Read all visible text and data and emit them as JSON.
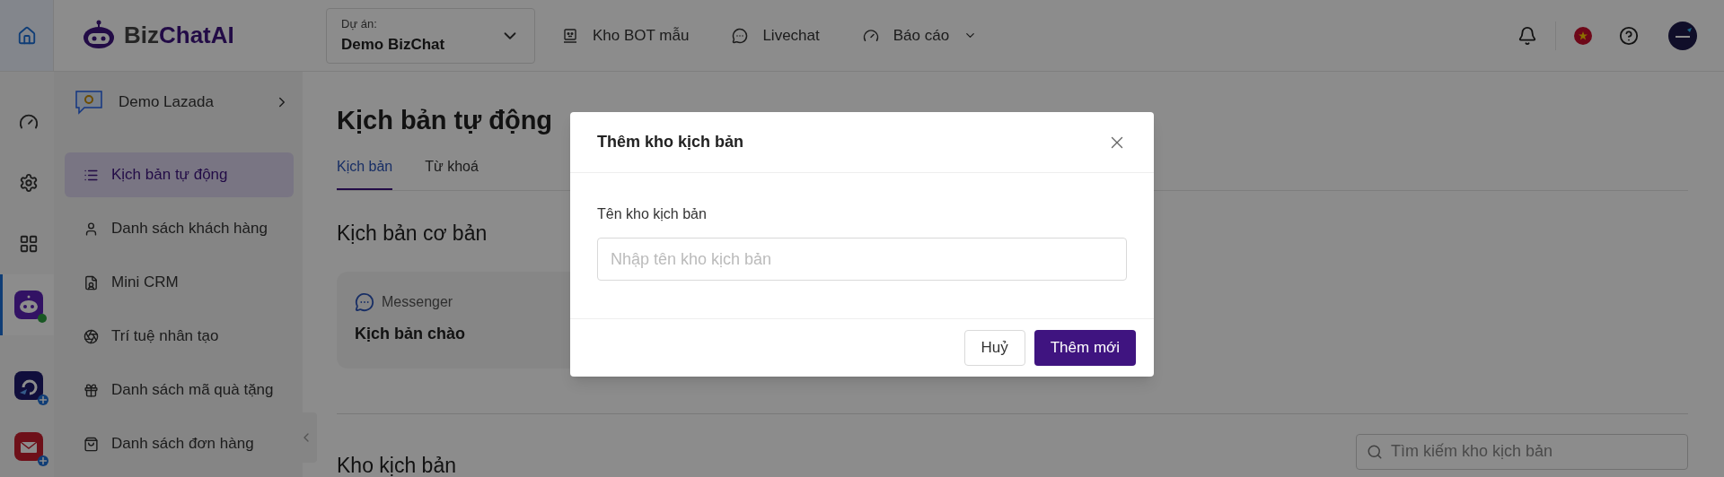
{
  "top_bar": {
    "home_selected": true,
    "logo": {
      "prefix": "Biz",
      "suffix": "ChatAI"
    },
    "project": {
      "label": "Dự án:",
      "value": "Demo BizChat"
    },
    "nav": [
      {
        "label": "Kho BOT mẫu",
        "kind": "bot",
        "dropdown": false
      },
      {
        "label": "Livechat",
        "kind": "chat",
        "dropdown": false
      },
      {
        "label": "Báo cáo",
        "kind": "report",
        "dropdown": true
      }
    ]
  },
  "rail": [
    {
      "kind": "dashboard",
      "selected": false,
      "online": false,
      "addable": false
    },
    {
      "kind": "settings",
      "selected": false,
      "online": false,
      "addable": false
    },
    {
      "kind": "apps",
      "selected": false,
      "online": false,
      "addable": false
    },
    {
      "kind": "bot",
      "selected": true,
      "online": true,
      "addable": false
    },
    {
      "kind": "flow",
      "selected": false,
      "online": false,
      "addable": true
    },
    {
      "kind": "mail",
      "selected": false,
      "online": false,
      "addable": true
    }
  ],
  "sidebar": {
    "workspace": "Demo Lazada",
    "items": [
      {
        "label": "Kịch bản tự động",
        "kind": "script",
        "selected": true
      },
      {
        "label": "Danh sách khách hàng",
        "kind": "user",
        "selected": false
      },
      {
        "label": "Mini CRM",
        "kind": "crm",
        "selected": false
      },
      {
        "label": "Trí tuệ nhân tạo",
        "kind": "ai",
        "selected": false
      },
      {
        "label": "Danh sách mã quà tặng",
        "kind": "gift",
        "selected": false
      },
      {
        "label": "Danh sách đơn hàng",
        "kind": "bag",
        "selected": false
      }
    ]
  },
  "main": {
    "title": "Kịch bản tự động",
    "tabs": [
      {
        "label": "Kịch bản",
        "selected": true
      },
      {
        "label": "Từ khoá",
        "selected": false
      }
    ],
    "basic_section": "Kịch bản cơ bản",
    "card": {
      "channel": "Messenger",
      "title": "Kịch bản chào"
    },
    "store_section": "Kho kịch bản",
    "search": {
      "placeholder": "Tìm kiếm kho kịch bản"
    }
  },
  "modal": {
    "title": "Thêm kho kịch bản",
    "field_label": "Tên kho kịch bản",
    "placeholder": "Nhập tên kho kịch bản",
    "buttons": [
      {
        "label": "Huỷ",
        "kind": "secondary"
      },
      {
        "label": "Thêm mới",
        "kind": "primary"
      }
    ]
  }
}
